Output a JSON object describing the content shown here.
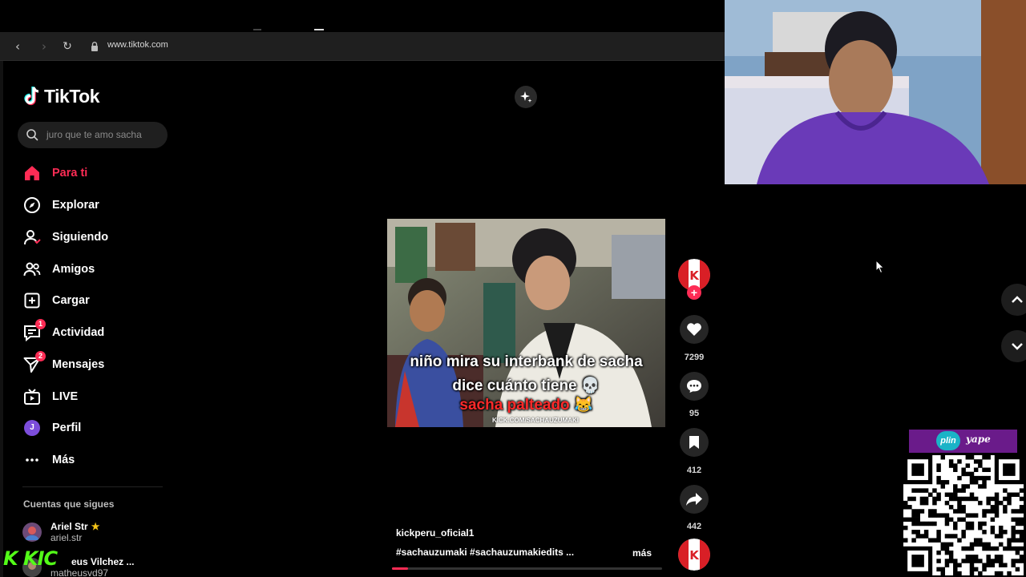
{
  "browser": {
    "url": "www.tiktok.com",
    "back_label": "‹",
    "forward_label": "›",
    "reload_label": "↻"
  },
  "app": {
    "logo_text": "TikTok",
    "search_placeholder": "juro que te amo sacha"
  },
  "nav": {
    "items": [
      {
        "label": "Para ti",
        "icon": "home-icon",
        "active": true
      },
      {
        "label": "Explorar",
        "icon": "compass-icon"
      },
      {
        "label": "Siguiendo",
        "icon": "following-icon"
      },
      {
        "label": "Amigos",
        "icon": "friends-icon"
      },
      {
        "label": "Cargar",
        "icon": "upload-icon"
      },
      {
        "label": "Actividad",
        "icon": "activity-icon",
        "badge": "1"
      },
      {
        "label": "Mensajes",
        "icon": "messages-icon",
        "badge": "2"
      },
      {
        "label": "LIVE",
        "icon": "live-icon"
      },
      {
        "label": "Perfil",
        "icon": "profile-avatar",
        "avatar_letter": "J"
      },
      {
        "label": "Más",
        "icon": "more-icon"
      }
    ]
  },
  "following": {
    "title": "Cuentas que sigues",
    "accounts": [
      {
        "name": "Ariel Str",
        "handle": "ariel.str",
        "verified_star": "★"
      },
      {
        "name": "eus Vilchez ...",
        "handle": "matheusvd97"
      }
    ]
  },
  "overlay": {
    "kick_text": "K KIC"
  },
  "video": {
    "caption_line1": "niño mira su interbank de sacha",
    "caption_line2": "dice cuánto tiene 💀",
    "caption_line3": "sacha palteado 😹",
    "watermark": "KICK.COM/SACHAUZUMAKI",
    "author": "kickperu_oficial1",
    "tags": "#sachauzumaki  #sachauzumakiedits  ...",
    "more_label": "más",
    "progress": 0.06
  },
  "actions": {
    "likes": "7299",
    "comments": "95",
    "saves": "412",
    "shares": "442",
    "follow_plus": "+"
  },
  "payment": {
    "plin_label": "plin",
    "yape_label": "yape"
  },
  "colors": {
    "accent": "#fe2c55",
    "page_bg": "#000000",
    "kick_green": "#53fc18",
    "yape_purple": "#6a1b8a"
  }
}
